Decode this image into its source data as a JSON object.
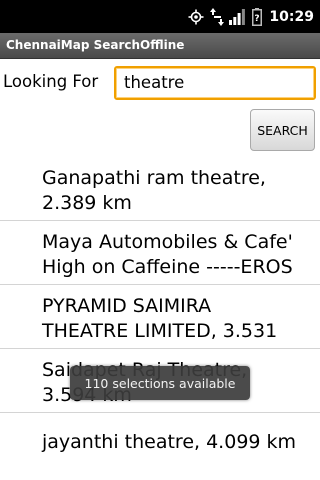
{
  "status_bar": {
    "time": "10:29",
    "icons": [
      "gps-icon",
      "network-3g-icon",
      "signal-icon",
      "battery-icon"
    ]
  },
  "app": {
    "title": "ChennaiMap SearchOffline"
  },
  "search": {
    "label": "Looking For",
    "value": "theatre",
    "button_label": "SEARCH"
  },
  "results": [
    {
      "line1": "Ganapathi ram theatre,",
      "line2": "2.389 km"
    },
    {
      "line1": "Maya Automobiles & Cafe'",
      "line2": "High on Caffeine -----EROS"
    },
    {
      "line1": "PYRAMID SAIMIRA",
      "line2": "THEATRE LIMITED,  3.531"
    },
    {
      "line1": "Saidapet Raj Theatre,",
      "line2": "3.594 km"
    },
    {
      "line1": "jayanthi theatre,  4.099 km",
      "line2": ""
    }
  ],
  "toast": {
    "message": "110 selections available"
  },
  "colors": {
    "status_bar_bg": "#000000",
    "title_bar_bg": "#555555",
    "input_focus_border": "#f0a000",
    "list_divider": "#d4d4d4"
  }
}
